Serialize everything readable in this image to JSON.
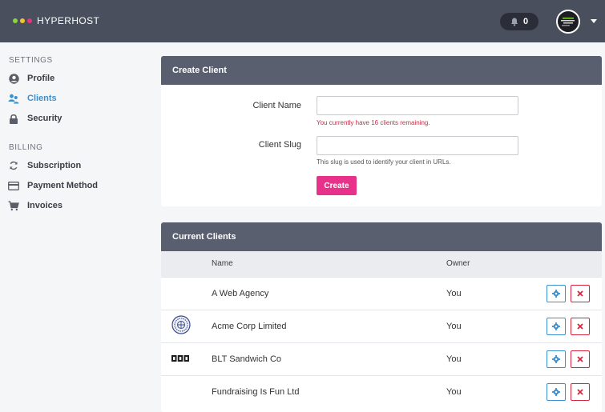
{
  "app": {
    "logo_text": "HYPERHOST",
    "brand_dots": [
      "#8bd53f",
      "#f5c42a",
      "#e83284"
    ]
  },
  "header": {
    "notification_count": "0"
  },
  "sidebar": {
    "settings_heading": "SETTINGS",
    "billing_heading": "BILLING",
    "items": [
      {
        "label": "Profile",
        "icon": "user-circle-icon"
      },
      {
        "label": "Clients",
        "icon": "users-icon",
        "active": true
      },
      {
        "label": "Security",
        "icon": "lock-icon"
      },
      {
        "label": "Subscription",
        "icon": "refresh-icon"
      },
      {
        "label": "Payment Method",
        "icon": "credit-card-icon"
      },
      {
        "label": "Invoices",
        "icon": "cart-icon"
      }
    ]
  },
  "create_client": {
    "title": "Create Client",
    "name_label": "Client Name",
    "name_value": "",
    "name_hint": "You currently have 16 clients remaining.",
    "slug_label": "Client Slug",
    "slug_value": "",
    "slug_hint": "This slug is used to identify your client in URLs.",
    "submit_label": "Create"
  },
  "current_clients": {
    "title": "Current Clients",
    "columns": [
      "",
      "Name",
      "Owner",
      ""
    ],
    "rows": [
      {
        "name": "A Web Agency",
        "owner": "You",
        "logo": "none"
      },
      {
        "name": "Acme Corp Limited",
        "owner": "You",
        "logo": "round-seal-logo"
      },
      {
        "name": "BLT Sandwich Co",
        "owner": "You",
        "logo": "bbc-style-logo"
      },
      {
        "name": "Fundraising Is Fun Ltd",
        "owner": "You",
        "logo": "none"
      }
    ]
  },
  "colors": {
    "topbar": "#4a4f5e",
    "panel_header": "#5a5f70",
    "accent": "#3a8fce",
    "primary_button": "#e8328a",
    "danger": "#d7263d",
    "hint_error": "#c0304a"
  }
}
